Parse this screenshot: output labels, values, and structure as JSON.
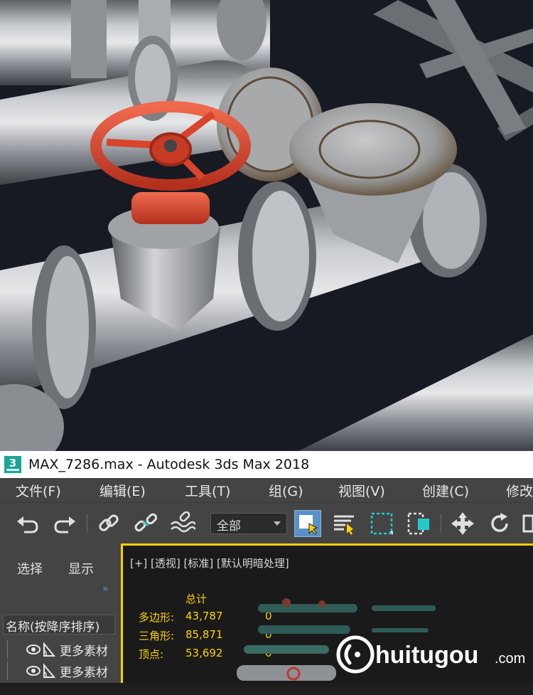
{
  "window": {
    "app_icon_glyph": "3",
    "title": "MAX_7286.max - Autodesk 3ds Max 2018"
  },
  "menu": [
    "文件(F)",
    "编辑(E)",
    "工具(T)",
    "组(G)",
    "视图(V)",
    "创建(C)",
    "修改"
  ],
  "toolbar": {
    "selection_filter": "全部",
    "icons": [
      "undo-icon",
      "redo-icon",
      "link-icon",
      "unlink-icon",
      "bind-spacewarp-icon",
      "select-object-icon",
      "select-by-name-icon",
      "rectangular-selection-icon",
      "window-crossing-icon",
      "move-icon",
      "rotate-icon"
    ]
  },
  "scene_explorer": {
    "tab_select": "选择",
    "tab_display": "显示",
    "expand": "»",
    "sort_header": "名称(按降序排序)",
    "rows": [
      "更多素材",
      "更多素材"
    ]
  },
  "viewport": {
    "label": "[+] [透视] [标准] [默认明暗处理]",
    "stats_header": "总计",
    "stats": [
      {
        "label": "多边形:",
        "value": "43,787",
        "selected": "0"
      },
      {
        "label": "三角形:",
        "value": "85,871",
        "selected": "0"
      },
      {
        "label": "顶点:",
        "value": "53,692",
        "selected": "0"
      }
    ]
  },
  "watermark": {
    "text": "huitugou",
    "suffix": ".com"
  },
  "colors": {
    "accent": "#ffd200",
    "selection": "#5b8fc7",
    "valve": "#d9442c",
    "teal": "#1aa59a"
  }
}
